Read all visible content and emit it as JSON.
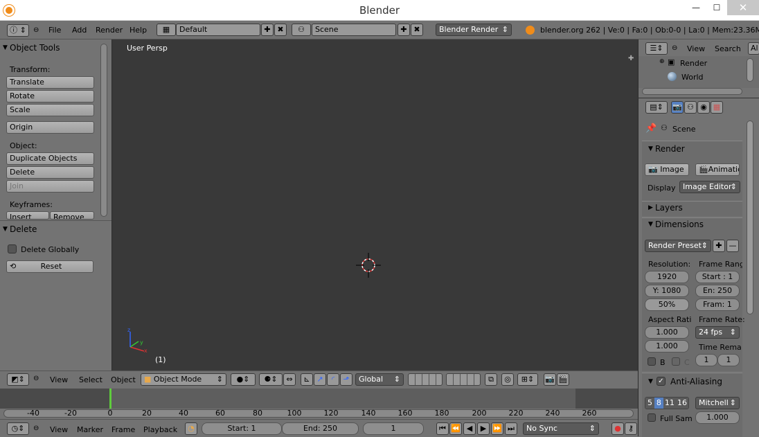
{
  "window": {
    "title": "Blender",
    "minimize": "—",
    "maximize": "☐",
    "close": "✕"
  },
  "topbar": {
    "menus": [
      "File",
      "Add",
      "Render",
      "Help"
    ],
    "layout": "Default",
    "scene": "Scene",
    "engine": "Blender Render",
    "stats": "blender.org 262 | Ve:0 | Fa:0 | Ob:0-0 | La:0 | Mem:23.36M (2"
  },
  "toolshelf": {
    "header": "Object Tools",
    "transform_label": "Transform:",
    "translate": "Translate",
    "rotate": "Rotate",
    "scale": "Scale",
    "origin": "Origin",
    "object_label": "Object:",
    "duplicate": "Duplicate Objects",
    "delete": "Delete",
    "join": "Join",
    "keyframes_label": "Keyframes:",
    "insert": "Insert",
    "remove": "Remove",
    "op_header": "Delete",
    "delete_globally": "Delete Globally",
    "reset": "Reset"
  },
  "viewport": {
    "label": "User Persp",
    "frame": "(1)"
  },
  "viewheader": {
    "view": "View",
    "select": "Select",
    "object": "Object",
    "mode": "Object Mode",
    "orientation": "Global"
  },
  "timeline": {
    "ticks": [
      "-40",
      "-20",
      "0",
      "20",
      "40",
      "60",
      "80",
      "100",
      "120",
      "140",
      "160",
      "180",
      "200",
      "220",
      "240",
      "260"
    ],
    "view": "View",
    "marker": "Marker",
    "frame": "Frame",
    "playback": "Playback",
    "start": "Start: 1",
    "end": "End: 250",
    "current": "1",
    "sync": "No Sync",
    "current_frame": 0
  },
  "outliner": {
    "view": "View",
    "search": "Search",
    "all": "Al",
    "items": [
      "Render",
      "World"
    ]
  },
  "properties": {
    "scene": "Scene",
    "render_header": "Render",
    "image_btn": "Image",
    "anim_btn": "Animatio",
    "display_label": "Display",
    "display_value": "Image Editor",
    "layers": "Layers",
    "dimensions": "Dimensions",
    "preset": "Render Preset",
    "resolution": "Resolution:",
    "frame_range": "Frame Rang",
    "res_x": "1920",
    "res_y": "Y: 1080",
    "res_pct": "50%",
    "start": "Start : 1",
    "end": "En: 250",
    "step": "Fram: 1",
    "aspect": "Aspect Rati",
    "frame_rate": "Frame Rate:",
    "asp_x": "1.000",
    "asp_y": "1.000",
    "fps": "24 fps",
    "time_remap": "Time Rema",
    "b_label": "B",
    "c_label": "C",
    "remap_old": "1",
    "remap_new": "1",
    "antialias": "Anti-Aliasing",
    "aa_samples": [
      "5",
      "8",
      "11",
      "16"
    ],
    "filter": "Mitchell",
    "full_sample": "Full Sam",
    "filter_size": "1.000"
  }
}
